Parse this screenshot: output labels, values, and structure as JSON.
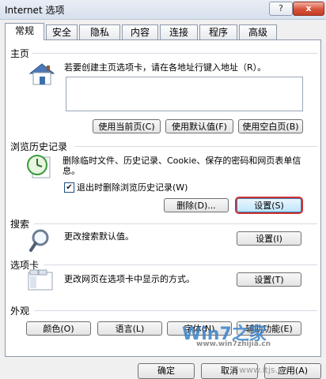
{
  "window": {
    "title": "Internet 选项",
    "help": "?",
    "close": "x"
  },
  "tabs": [
    "常规",
    "安全",
    "隐私",
    "内容",
    "连接",
    "程序",
    "高级"
  ],
  "homepage": {
    "title": "主页",
    "desc": "若要创建主页选项卡，请在各地址行键入地址（R）。",
    "url": "",
    "btn_current": "使用当前页(C)",
    "btn_default": "使用默认值(F)",
    "btn_blank": "使用空白页(B)"
  },
  "history": {
    "title": "浏览历史记录",
    "desc": "删除临时文件、历史记录、Cookie、保存的密码和网页表单信息。",
    "checkbox_label": "退出时删除浏览历史记录(W)",
    "checkbox_checked": true,
    "btn_delete": "删除(D)...",
    "btn_settings": "设置(S)"
  },
  "search": {
    "title": "搜索",
    "desc": "更改搜索默认值。",
    "btn_settings": "设置(I)"
  },
  "tabsection": {
    "title": "选项卡",
    "desc": "更改网页在选项卡中显示的方式。",
    "btn_settings": "设置(T)"
  },
  "appearance": {
    "title": "外观",
    "btn_colors": "颜色(O)",
    "btn_languages": "语言(L)",
    "btn_fonts": "字体(N)",
    "btn_accessibility": "辅助功能(E)"
  },
  "footer": {
    "ok": "确定",
    "cancel": "取消",
    "apply": "应用(A)"
  },
  "watermark": {
    "text": "Win7之家",
    "sub": "www.win7zhijia.cn",
    "url": "www.itjs.cn"
  }
}
